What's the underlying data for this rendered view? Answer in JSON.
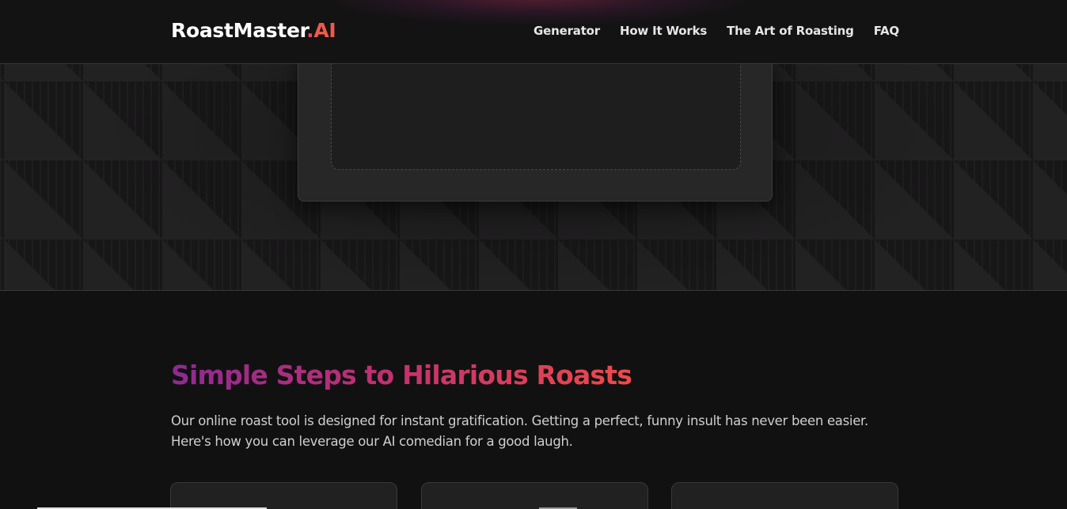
{
  "header": {
    "logo_main": "RoastMaster",
    "logo_dot": ".",
    "logo_ai": "AI",
    "nav": [
      {
        "label": "Generator"
      },
      {
        "label": "How It Works"
      },
      {
        "label": "The Art of Roasting"
      },
      {
        "label": "FAQ"
      }
    ]
  },
  "steps": {
    "title": "Simple Steps to Hilarious Roasts",
    "description": "Our online roast tool is designed for instant gratification. Getting a perfect, funny insult has never been easier. Here's how you can leverage our AI comedian for a good laugh."
  },
  "colors": {
    "background": "#121112",
    "accent_start": "#8e2a93",
    "accent_end": "#ee4a4a",
    "logo_ai": "#f05a4a"
  }
}
